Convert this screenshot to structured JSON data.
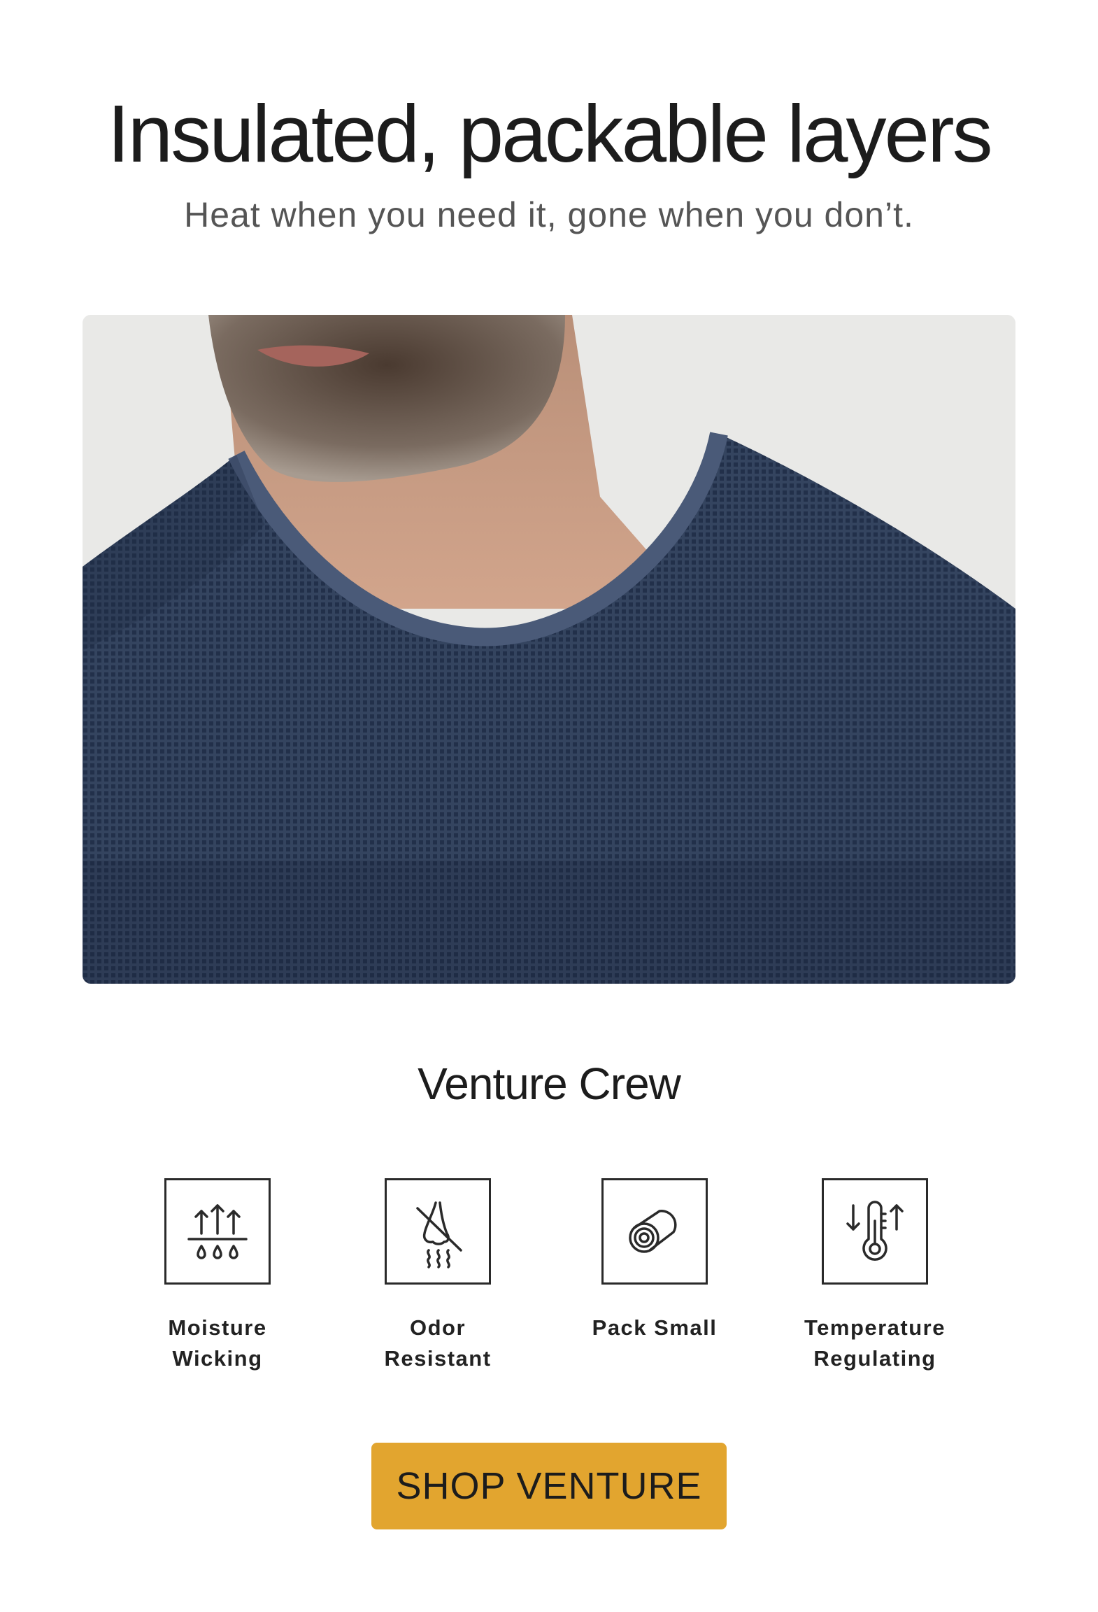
{
  "header": {
    "title": "Insulated, packable layers",
    "subtitle": "Heat when you need it, gone when you don’t."
  },
  "product": {
    "name": "Venture Crew"
  },
  "features": [
    {
      "label": "Moisture Wicking",
      "icon": "moisture-wicking-icon"
    },
    {
      "label": "Odor Resistant",
      "icon": "odor-resistant-icon"
    },
    {
      "label": "Pack Small",
      "icon": "pack-small-icon"
    },
    {
      "label": "Temperature Regulating",
      "icon": "temperature-regulating-icon"
    }
  ],
  "cta": {
    "label": "SHOP VENTURE"
  },
  "colors": {
    "cta_background": "#e2a52f",
    "shirt": "#2f3e58",
    "photo_background": "#e9e9e7"
  }
}
